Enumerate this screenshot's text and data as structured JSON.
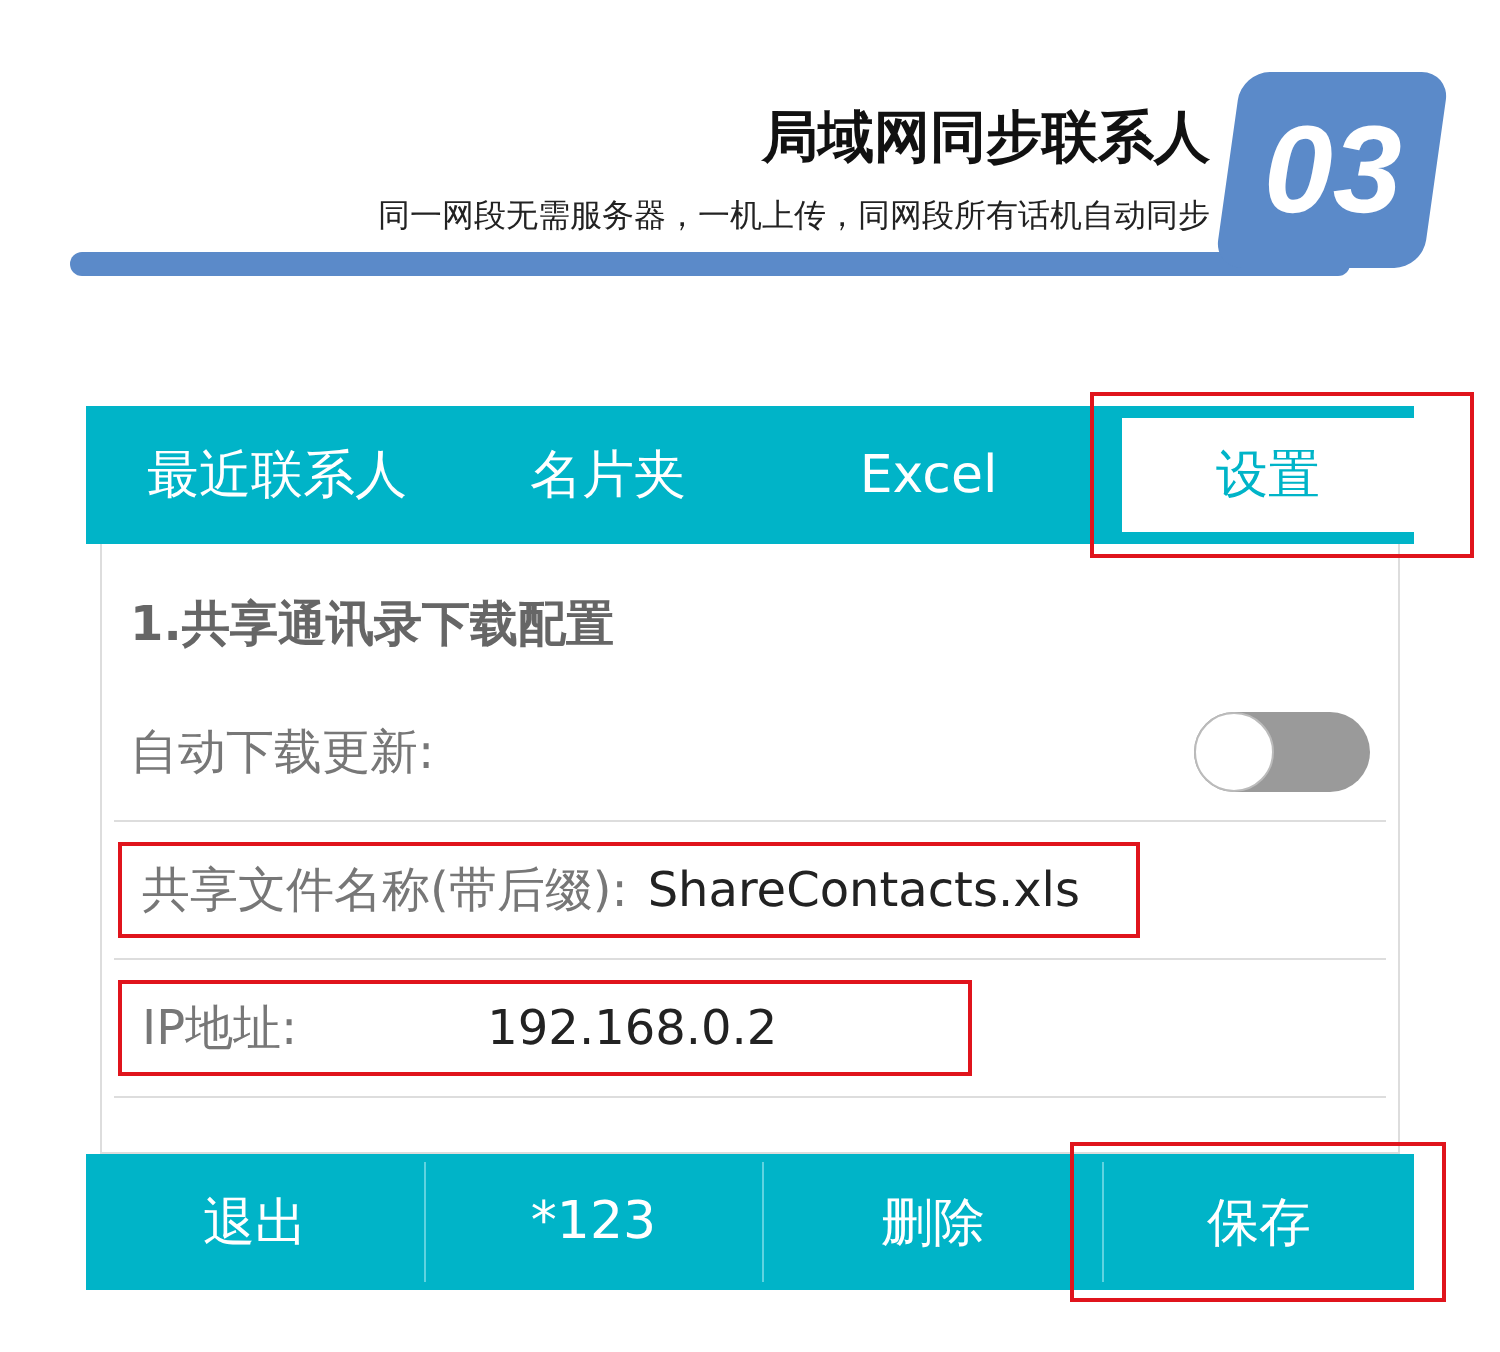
{
  "header": {
    "title": "局域网同步联系人",
    "subtitle": "同一网段无需服务器，一机上传，同网段所有话机自动同步",
    "number": "03"
  },
  "tabs": [
    {
      "label": "最近联系人",
      "selected": false,
      "highlighted": false
    },
    {
      "label": "名片夹",
      "selected": false,
      "highlighted": false
    },
    {
      "label": "Excel",
      "selected": false,
      "highlighted": false
    },
    {
      "label": "设置",
      "selected": true,
      "highlighted": true
    }
  ],
  "section_title": "1.共享通讯录下载配置",
  "settings": [
    {
      "kind": "toggle",
      "label": "自动下载更新:",
      "on": false
    },
    {
      "kind": "field",
      "label": "共享文件名称(带后缀):",
      "value": "ShareContacts.xls",
      "highlighted": true
    },
    {
      "kind": "field",
      "label": "IP地址:",
      "value": "192.168.0.2",
      "highlighted": true
    }
  ],
  "buttons": [
    {
      "label": "退出",
      "highlighted": false
    },
    {
      "label": "*123",
      "highlighted": false
    },
    {
      "label": "删除",
      "highlighted": false
    },
    {
      "label": "保存",
      "highlighted": true
    }
  ]
}
